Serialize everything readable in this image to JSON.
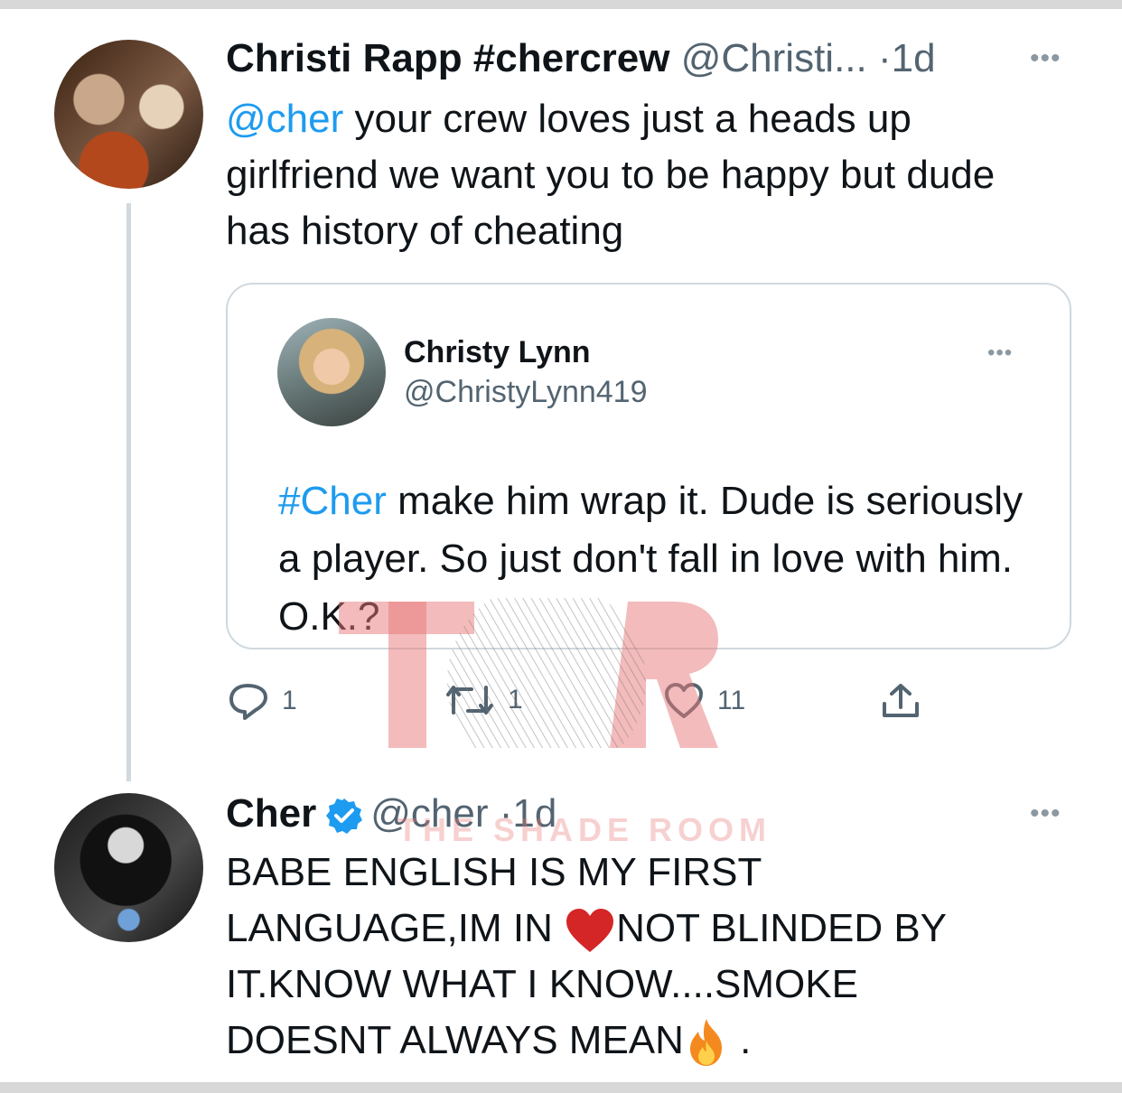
{
  "tweet1": {
    "name": "Christi Rapp #chercrew",
    "handle": "@Christi...",
    "separator": "·",
    "time": "1d",
    "more_icon": "more-icon",
    "mention": "@cher",
    "text": " your crew loves just a heads up girlfriend we want you to be happy but dude has history of cheating",
    "quoted": {
      "name": "Christy Lynn",
      "handle": "@ChristyLynn419",
      "hashtag": "#Cher",
      "text": " make him wrap it. Dude is seriously a player. So just don't fall in love with him. O.K.?"
    },
    "actions": {
      "reply_count": "1",
      "retweet_count": "1",
      "like_count": "11"
    }
  },
  "tweet2": {
    "name": "Cher",
    "handle": "@cher",
    "separator": "·",
    "time": "1d",
    "verified": true,
    "text_line1": "BABE ENGLISH IS MY FIRST",
    "text_line2a": "LANGUAGE,IM IN ",
    "text_line2b": "NOT BLINDED BY",
    "text_line3": "IT.KNOW WHAT  I KNOW....SMOKE",
    "text_line4a": "DOESNT ALWAYS MEAN",
    "text_line4b": " ."
  },
  "watermark": {
    "logo": "TSR",
    "text": "THE SHADE ROOM"
  },
  "colors": {
    "link": "#1d9bf0",
    "muted": "#536471",
    "watermark": "#e87878"
  }
}
